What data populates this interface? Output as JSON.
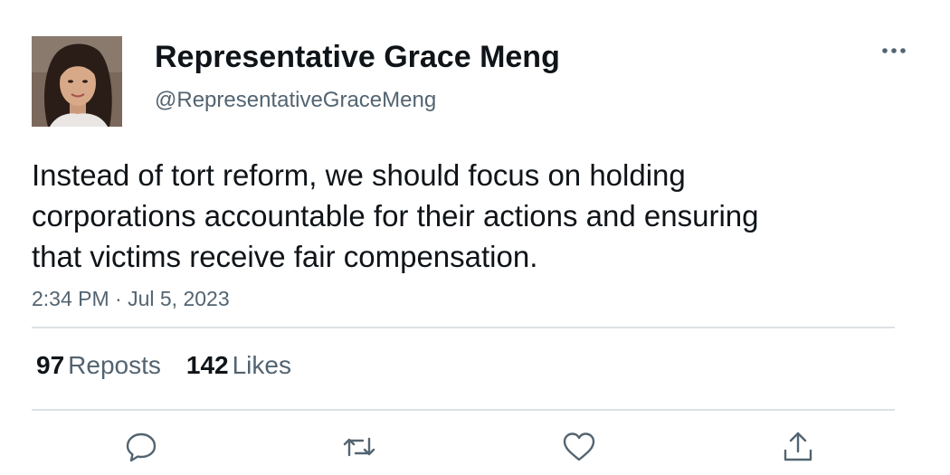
{
  "tweet": {
    "author": {
      "display_name": "Representative Grace Meng",
      "handle": "@RepresentativeGraceMeng"
    },
    "text": "Instead of tort reform, we should focus on holding corporations accountable for their actions and ensuring that victims receive fair compensation.",
    "timestamp": "2:34 PM · Jul 5, 2023",
    "stats": {
      "reposts_count": "97",
      "reposts_label": "Reposts",
      "likes_count": "142",
      "likes_label": "Likes"
    }
  },
  "icons": {
    "more": "more-horizontal-icon",
    "reply": "reply-icon",
    "repost": "repost-icon",
    "like": "heart-icon",
    "share": "share-icon"
  },
  "colors": {
    "text_primary": "#0f1419",
    "text_secondary": "#536471",
    "divider": "#dde1e4",
    "icon": "#536471"
  }
}
